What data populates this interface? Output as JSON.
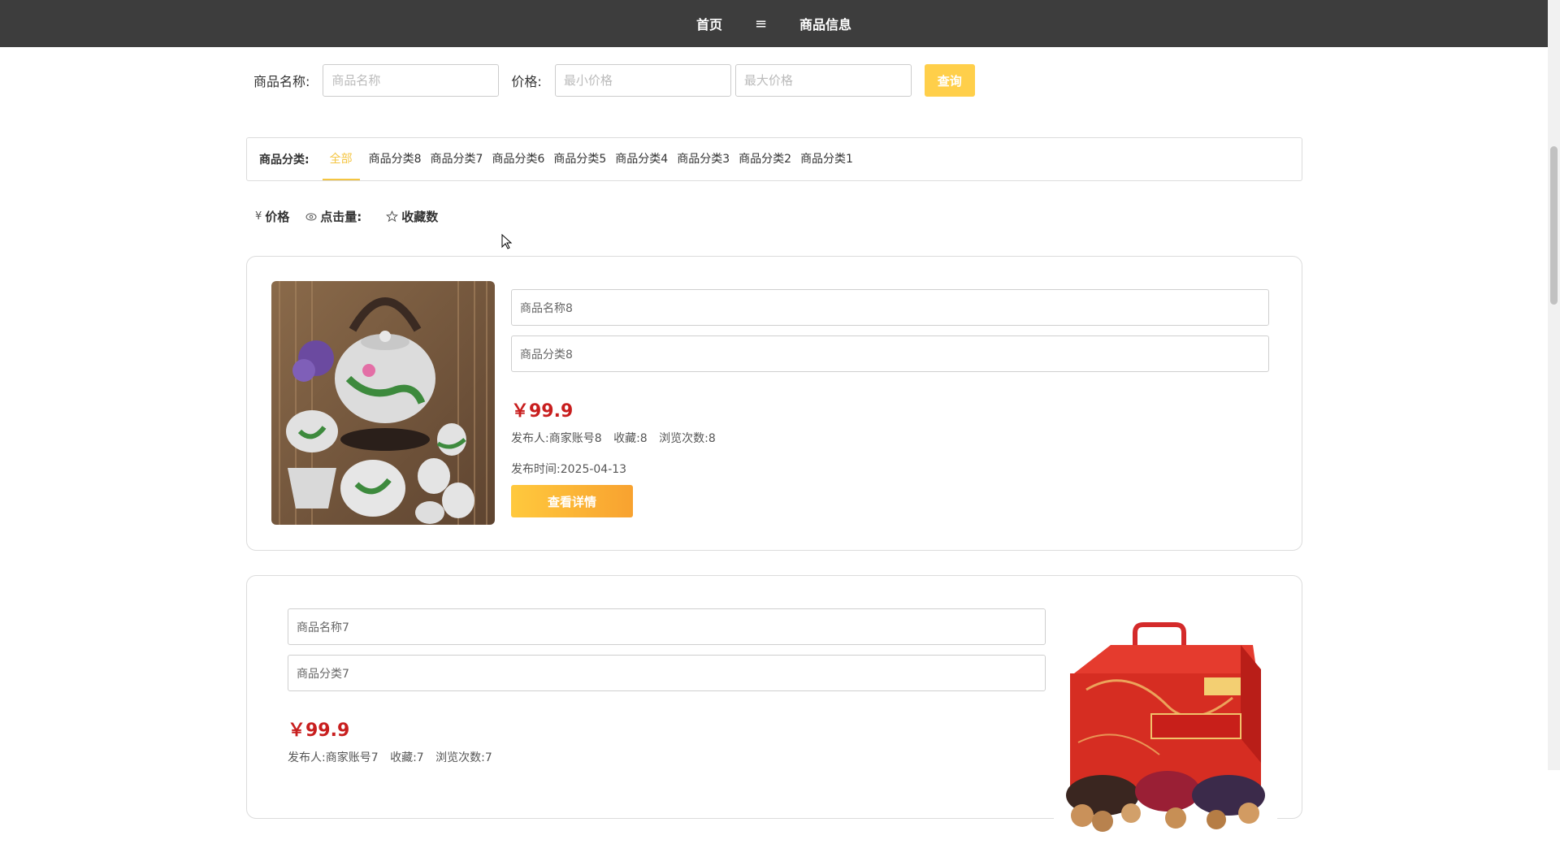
{
  "nav": {
    "home": "首页",
    "product_info": "商品信息"
  },
  "search": {
    "name_label": "商品名称:",
    "name_placeholder": "商品名称",
    "price_label": "价格:",
    "min_placeholder": "最小价格",
    "max_placeholder": "最大价格",
    "query_button": "查询"
  },
  "categories": {
    "label": "商品分类:",
    "items": [
      "全部",
      "商品分类8",
      "商品分类7",
      "商品分类6",
      "商品分类5",
      "商品分类4",
      "商品分类3",
      "商品分类2",
      "商品分类1"
    ],
    "active": "全部"
  },
  "sort": {
    "price": "价格",
    "price_icon": "¥",
    "clicks": "点击量:",
    "favorites": "收藏数"
  },
  "products": [
    {
      "name": "商品名称8",
      "category": "商品分类8",
      "price": "￥99.9",
      "publisher": "发布人:商家账号8",
      "favorites": "收藏:8",
      "views": "浏览次数:8",
      "publish_time": "发布时间:2025-04-13",
      "detail_button": "查看详情",
      "image_icon": "teapot-set-image"
    },
    {
      "name": "商品名称7",
      "category": "商品分类7",
      "price": "￥99.9",
      "publisher": "发布人:商家账号7",
      "favorites": "收藏:7",
      "views": "浏览次数:7",
      "image_icon": "gift-box-image"
    }
  ],
  "colors": {
    "topbar": "#3d3d3d",
    "accent": "#f4c542",
    "price": "#c81e1e"
  }
}
